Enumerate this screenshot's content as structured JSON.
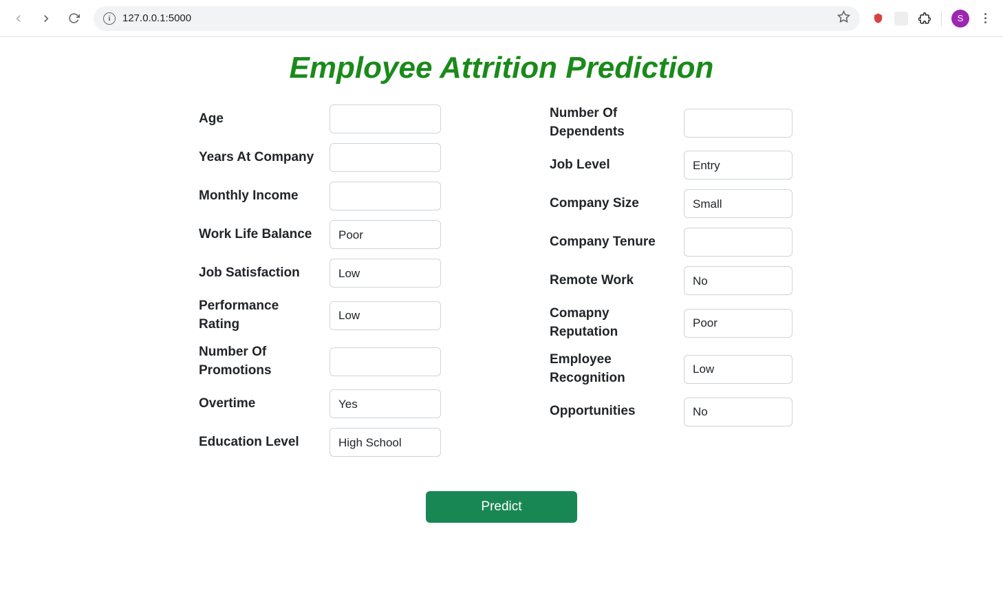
{
  "browser": {
    "url": "127.0.0.1:5000",
    "avatar_letter": "S"
  },
  "page": {
    "title": "Employee Attrition Prediction",
    "predict_label": "Predict"
  },
  "left_fields": [
    {
      "label": "Age",
      "type": "text",
      "value": ""
    },
    {
      "label": "Years At Company",
      "type": "text",
      "value": ""
    },
    {
      "label": "Monthly Income",
      "type": "text",
      "value": ""
    },
    {
      "label": "Work Life Balance",
      "type": "select",
      "value": "Poor"
    },
    {
      "label": "Job Satisfaction",
      "type": "select",
      "value": "Low"
    },
    {
      "label": "Performance Rating",
      "type": "select",
      "value": "Low"
    },
    {
      "label": "Number Of Promotions",
      "type": "text",
      "value": ""
    },
    {
      "label": "Overtime",
      "type": "select",
      "value": "Yes"
    },
    {
      "label": "Education Level",
      "type": "select",
      "value": "High School"
    }
  ],
  "right_fields": [
    {
      "label": "Number Of Dependents",
      "type": "text",
      "value": ""
    },
    {
      "label": "Job Level",
      "type": "select",
      "value": "Entry"
    },
    {
      "label": "Company Size",
      "type": "select",
      "value": "Small"
    },
    {
      "label": "Company Tenure",
      "type": "text",
      "value": ""
    },
    {
      "label": "Remote Work",
      "type": "select",
      "value": "No"
    },
    {
      "label": "Comapny Reputation",
      "type": "select",
      "value": "Poor"
    },
    {
      "label": "Employee Recognition",
      "type": "select",
      "value": "Low"
    },
    {
      "label": "Opportunities",
      "type": "select",
      "value": "No"
    }
  ]
}
